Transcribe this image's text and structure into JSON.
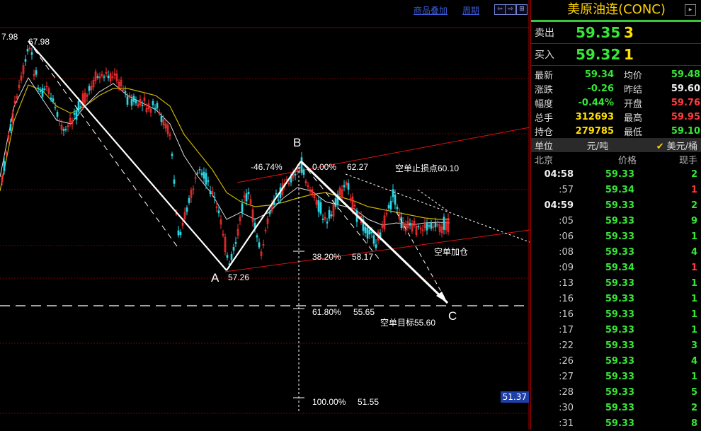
{
  "toolbar": {
    "overlay_label": "商品叠加",
    "period_label": "周期",
    "zoom_in": "⇦",
    "zoom_out": "⇨",
    "expand": "⊞"
  },
  "chart": {
    "axis_marker": "51.37",
    "labels": {
      "high_left": "7.98",
      "high_left2": "67.98",
      "point_A": "A",
      "point_B": "B",
      "point_C": "C",
      "low_A": "57.26",
      "pct_neg": "-46.74%",
      "pct_zero": "0.00%",
      "val_62": "62.27",
      "stop_loss": "空单止损点60.10",
      "fib382": "38.20%",
      "val_5817": "58.17",
      "add_position": "空单加仓",
      "fib618": "61.80%",
      "val_5565": "55.65",
      "target": "空单目标55.60",
      "fib100": "100.00%",
      "val_5155": "51.55"
    }
  },
  "panel": {
    "title": "美原油连(CONC)",
    "ask": {
      "label": "卖出",
      "price": "59.35",
      "vol": "3"
    },
    "bid": {
      "label": "买入",
      "price": "59.32",
      "vol": "1"
    },
    "stats": [
      {
        "k": "最新",
        "v": "59.34",
        "vc": "g",
        "k2": "均价",
        "v2": "59.48",
        "v2c": "g"
      },
      {
        "k": "涨跌",
        "v": "-0.26",
        "vc": "g",
        "k2": "昨结",
        "v2": "59.60",
        "v2c": "w"
      },
      {
        "k": "幅度",
        "v": "-0.44%",
        "vc": "g",
        "k2": "开盘",
        "v2": "59.76",
        "v2c": "r"
      },
      {
        "k": "总手",
        "v": "312693",
        "vc": "y",
        "k2": "最高",
        "v2": "59.95",
        "v2c": "r"
      },
      {
        "k": "持仓",
        "v": "279785",
        "vc": "y",
        "k2": "最低",
        "v2": "59.10",
        "v2c": "g"
      }
    ],
    "unit": {
      "label": "单位",
      "cny": "元/吨",
      "usd": "美元/桶"
    },
    "table_head": {
      "time": "北京",
      "price": "价格",
      "vol": "现手"
    },
    "ticks": [
      {
        "t": "04:58",
        "p": "59.33",
        "pc": "g",
        "q": "2",
        "qc": "g",
        "big": true
      },
      {
        "t": ":57",
        "p": "59.34",
        "pc": "g",
        "q": "1",
        "qc": "r"
      },
      {
        "t": "04:59",
        "p": "59.33",
        "pc": "g",
        "q": "2",
        "qc": "g",
        "big": true
      },
      {
        "t": ":05",
        "p": "59.33",
        "pc": "g",
        "q": "9",
        "qc": "g"
      },
      {
        "t": ":06",
        "p": "59.33",
        "pc": "g",
        "q": "1",
        "qc": "g"
      },
      {
        "t": ":08",
        "p": "59.33",
        "pc": "g",
        "q": "4",
        "qc": "g"
      },
      {
        "t": ":09",
        "p": "59.34",
        "pc": "g",
        "q": "1",
        "qc": "r"
      },
      {
        "t": ":13",
        "p": "59.33",
        "pc": "g",
        "q": "1",
        "qc": "g"
      },
      {
        "t": ":16",
        "p": "59.33",
        "pc": "g",
        "q": "1",
        "qc": "g"
      },
      {
        "t": ":16",
        "p": "59.33",
        "pc": "g",
        "q": "1",
        "qc": "g"
      },
      {
        "t": ":17",
        "p": "59.33",
        "pc": "g",
        "q": "1",
        "qc": "g"
      },
      {
        "t": ":22",
        "p": "59.33",
        "pc": "g",
        "q": "3",
        "qc": "g"
      },
      {
        "t": ":26",
        "p": "59.33",
        "pc": "g",
        "q": "4",
        "qc": "g"
      },
      {
        "t": ":27",
        "p": "59.33",
        "pc": "g",
        "q": "1",
        "qc": "g"
      },
      {
        "t": ":28",
        "p": "59.33",
        "pc": "g",
        "q": "5",
        "qc": "g"
      },
      {
        "t": ":30",
        "p": "59.33",
        "pc": "g",
        "q": "2",
        "qc": "g"
      },
      {
        "t": ":31",
        "p": "59.33",
        "pc": "g",
        "q": "8",
        "qc": "g"
      }
    ]
  }
}
